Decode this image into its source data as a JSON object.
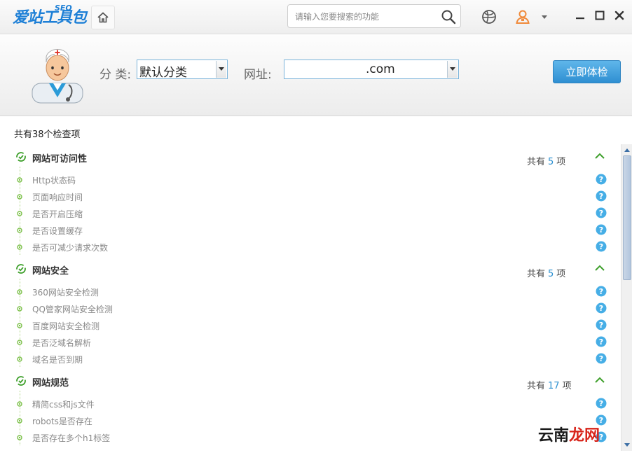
{
  "app": {
    "logo_main": "爱站工具包",
    "logo_sub": "SEO",
    "search_placeholder": "请输入您要搜索的功能"
  },
  "header": {
    "category_label": "分 类:",
    "category_value": "默认分类",
    "url_label": "网址:",
    "url_value": ".com",
    "start_button": "立即体检"
  },
  "summary": "共有38个检查项",
  "count_prefix": "共有",
  "count_suffix": "项",
  "categories": [
    {
      "title": "网站可访问性",
      "count": "5",
      "items": [
        "Http状态码",
        "页面响应时间",
        "是否开启压缩",
        "是否设置缓存",
        "是否可减少请求次数"
      ]
    },
    {
      "title": "网站安全",
      "count": "5",
      "items": [
        "360网站安全检测",
        "QQ管家网站安全检测",
        "百度网站安全检测",
        "是否泛域名解析",
        "域名是否到期"
      ]
    },
    {
      "title": "网站规范",
      "count": "17",
      "items": [
        "精简css和js文件",
        "robots是否存在",
        "是否存在多个h1标签"
      ]
    }
  ],
  "watermark": {
    "part1": "云南",
    "part2": "龙网"
  },
  "colors": {
    "accent": "#2a8fd0",
    "green": "#3fa02c",
    "help": "#46aee6"
  }
}
